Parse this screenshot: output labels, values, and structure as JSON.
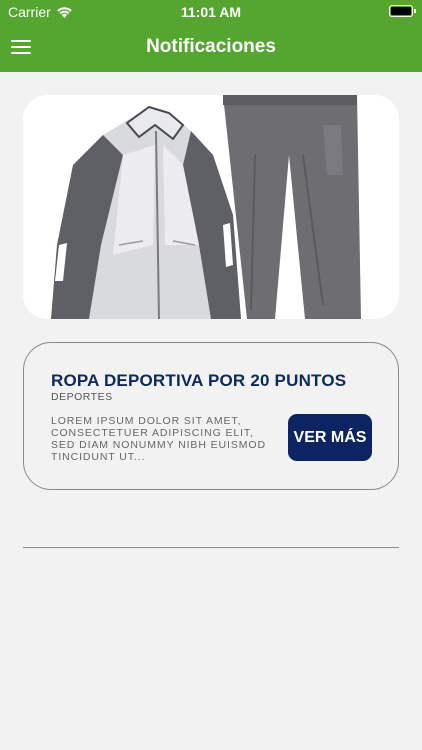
{
  "status_bar": {
    "carrier": "Carrier",
    "time": "11:01 AM",
    "battery_level": 1.0
  },
  "header": {
    "title": "Notificaciones",
    "menu_icon": "hamburger-menu-icon"
  },
  "notification": {
    "image_alt": "tracksuit-product-image",
    "title": "ROPA DEPORTIVA POR 20 PUNTOS",
    "category": "DEPORTES",
    "description": "LOREM IPSUM DOLOR SIT AMET, CONSECTETUER ADIPISCING ELIT, SED DIAM NONUMMY NIBH EUISMOD TINCIDUNT UT...",
    "button_label": "VER MÁS"
  },
  "colors": {
    "header": "#55a630",
    "primary_button": "#0c2461",
    "title_text": "#0d2a5c",
    "background": "#f2f2f2"
  }
}
